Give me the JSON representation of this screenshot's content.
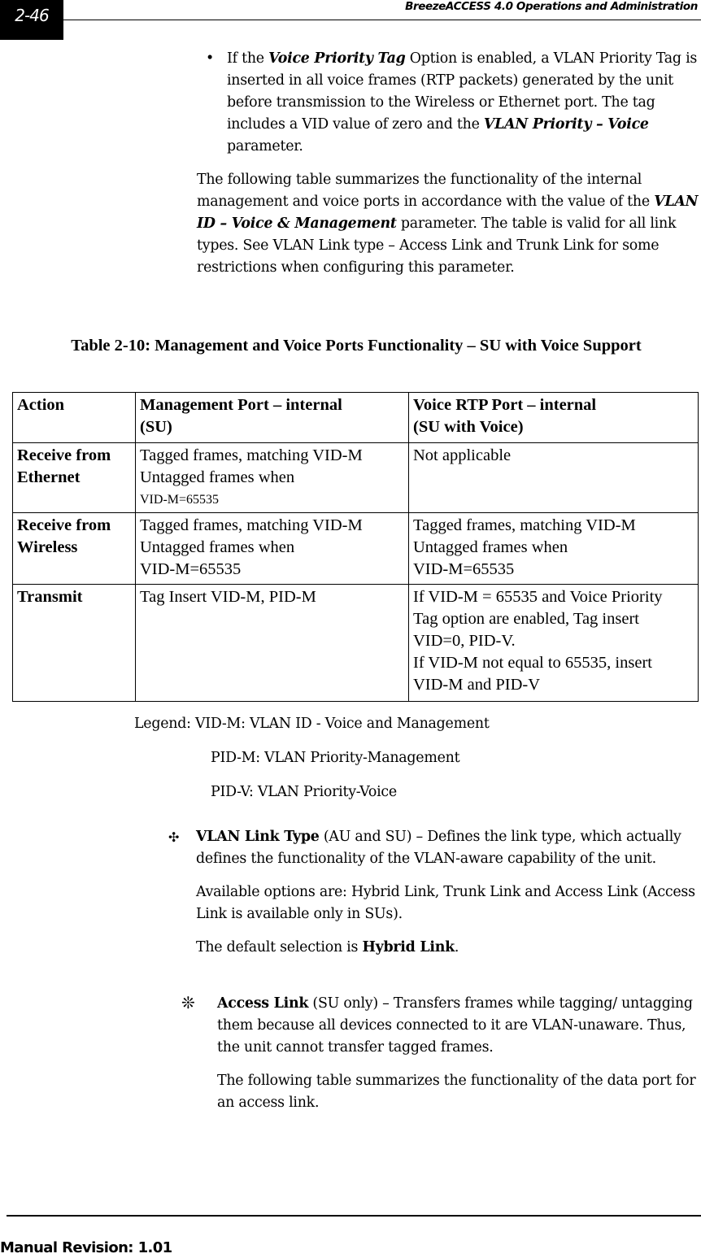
{
  "header": {
    "page_number": "2-46",
    "title": "BreezeACCESS 4.0 Operations and Administration"
  },
  "bullet": {
    "icon": "bullet-dot",
    "glyph": "•",
    "pre": "If the ",
    "emph1": "Voice Priority Tag",
    "mid": " Option is enabled, a VLAN Priority Tag is inserted in all voice frames (RTP packets) generated by the unit before transmission to the Wireless or Ethernet port. The tag includes a VID value of zero and the ",
    "emph2": "VLAN Priority – Voice",
    "post": " parameter."
  },
  "paragraph1": {
    "pre": "The following table summarizes the functionality of the internal management and voice ports in accordance with the value of the ",
    "emph": "VLAN ID – Voice & Management",
    "post": " parameter. The table is valid for all link types. See VLAN Link type – Access Link and Trunk Link for some restrictions when configuring this parameter."
  },
  "table": {
    "caption": "Table 2-10: Management and Voice Ports Functionality – SU with Voice Support",
    "headers": [
      [
        "Action"
      ],
      [
        "Management Port – internal",
        "(SU)"
      ],
      [
        "Voice RTP Port – internal",
        "(SU with Voice)"
      ]
    ],
    "rows": [
      {
        "action": [
          "Receive from",
          "Ethernet"
        ],
        "management": [
          "Tagged frames, matching VID-M",
          "Untagged frames when",
          "VID-M=65535"
        ],
        "voice": [
          "Not applicable"
        ]
      },
      {
        "action": [
          "Receive from",
          "Wireless"
        ],
        "management": [
          "Tagged frames, matching VID-M",
          "Untagged frames when",
          "VID-M=65535"
        ],
        "voice": [
          "Tagged frames, matching VID-M",
          "Untagged frames when",
          "VID-M=65535"
        ]
      },
      {
        "action": [
          "Transmit"
        ],
        "management": [
          "Tag Insert VID-M, PID-M"
        ],
        "voice": [
          "If VID-M = 65535 and Voice Priority",
          "Tag option are enabled, Tag insert",
          "VID=0, PID-V.",
          "If VID-M not equal to 65535, insert",
          "VID-M and PID-V"
        ]
      }
    ]
  },
  "legend": {
    "line1": "Legend: VID-M: VLAN ID - Voice and Management",
    "line2": "PID-M: VLAN Priority-Management",
    "line3": "PID-V: VLAN Priority-Voice"
  },
  "parameter": {
    "icon": "four-dot-cross",
    "glyph": "✣",
    "name": "VLAN Link Type",
    "description": " (AU and SU) – Defines the link type, which actually defines the functionality of the VLAN-aware capability of the unit.",
    "options_text": "Available options are: Hybrid Link, Trunk Link and Access Link (Access Link is available only in SUs).",
    "default_pre": "The default selection is ",
    "default_value": "Hybrid Link",
    "default_post": "."
  },
  "sub_option": {
    "icon": "asterisk",
    "glyph": "❊",
    "name": "Access Link",
    "description": " (SU only) – Transfers frames while tagging/ untagging them because all devices connected to it are VLAN-unaware. Thus, the unit cannot transfer tagged frames.",
    "followup": "The following table summarizes the functionality of the data port for an access link."
  },
  "footer": {
    "text": "Manual Revision: 1.01"
  }
}
